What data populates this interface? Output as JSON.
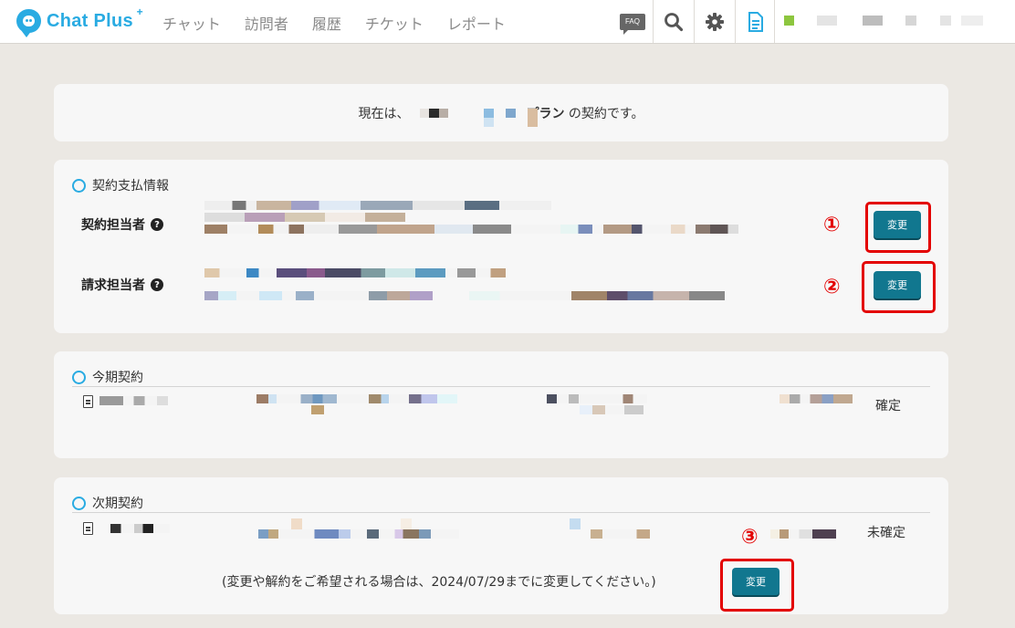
{
  "header": {
    "logo_text": "Chat Plus",
    "logo_plus": "+",
    "nav": [
      "チャット",
      "訪問者",
      "履歴",
      "チケット",
      "レポート"
    ],
    "faq_label": "FAQ",
    "icons": [
      "faq-icon",
      "search-icon",
      "gear-icon",
      "document-icon"
    ]
  },
  "plan": {
    "prefix": "現在は、",
    "plan_suffix": "プラン",
    "suffix": " の契約です。"
  },
  "billing": {
    "section_title": "契約支払情報",
    "contract_person_label": "契約担当者",
    "billing_person_label": "請求担当者",
    "change_label": "変更"
  },
  "current_contract": {
    "section_title": "今期契約",
    "status": "確定"
  },
  "next_contract": {
    "section_title": "次期契約",
    "status": "未確定",
    "note": "(変更や解約をご希望される場合は、2024/07/29までに変更してください。)",
    "change_label": "変更"
  },
  "annotations": [
    "①",
    "②",
    "③"
  ],
  "colors": {
    "accent": "#29abe2",
    "button": "#11778f",
    "highlight": "#e30000"
  }
}
